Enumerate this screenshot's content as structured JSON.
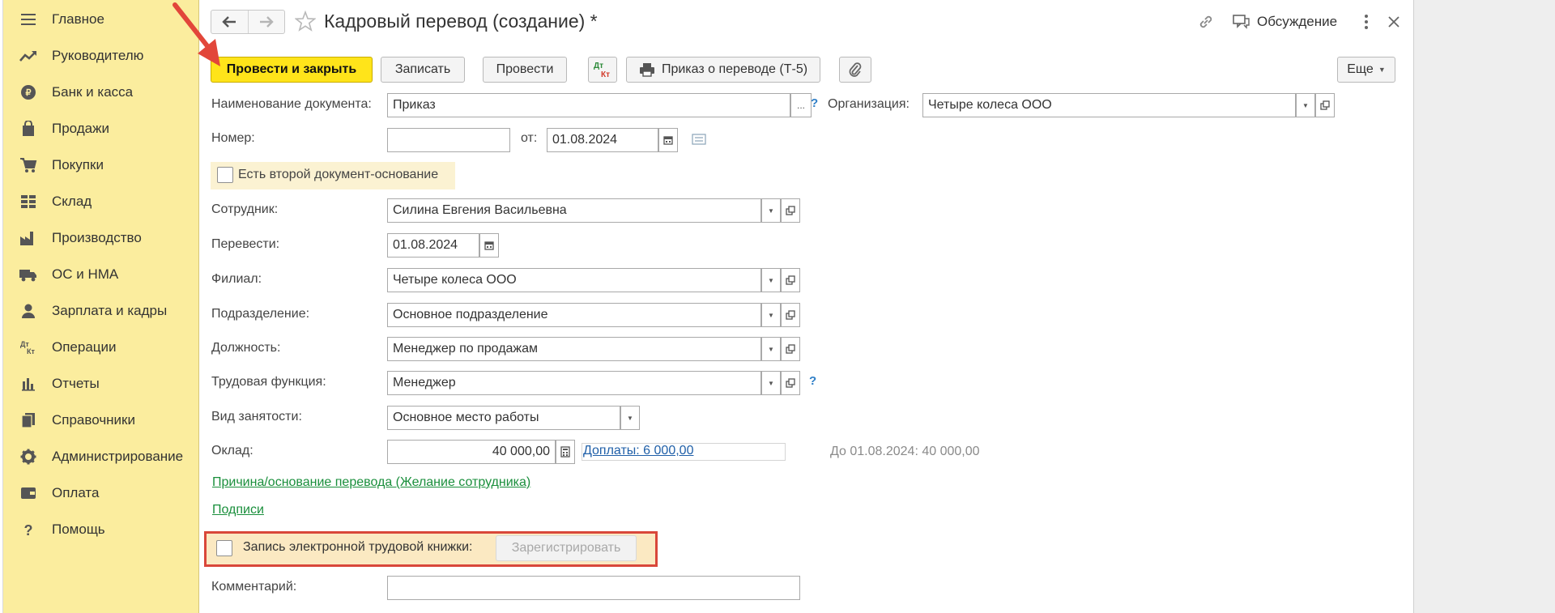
{
  "sidebar": {
    "items": [
      {
        "label": "Главное",
        "icon": "menu-lines-icon"
      },
      {
        "label": "Руководителю",
        "icon": "trend-chart-icon"
      },
      {
        "label": "Банк и касса",
        "icon": "coin-icon"
      },
      {
        "label": "Продажи",
        "icon": "shopping-bag-icon"
      },
      {
        "label": "Покупки",
        "icon": "cart-icon"
      },
      {
        "label": "Склад",
        "icon": "warehouse-grid-icon"
      },
      {
        "label": "Производство",
        "icon": "factory-icon"
      },
      {
        "label": "ОС и НМА",
        "icon": "truck-icon"
      },
      {
        "label": "Зарплата и кадры",
        "icon": "person-icon"
      },
      {
        "label": "Операции",
        "icon": "dt-kt-icon"
      },
      {
        "label": "Отчеты",
        "icon": "bar-chart-icon"
      },
      {
        "label": "Справочники",
        "icon": "book-icon"
      },
      {
        "label": "Администрирование",
        "icon": "gear-icon"
      },
      {
        "label": "Оплата",
        "icon": "wallet-icon"
      },
      {
        "label": "Помощь",
        "icon": "question-icon"
      }
    ]
  },
  "header": {
    "title": "Кадровый перевод (создание) *",
    "discuss_label": "Обсуждение"
  },
  "toolbar": {
    "post_close": "Провести и закрыть",
    "save": "Записать",
    "post": "Провести",
    "dt_kt": "Дт Кт",
    "print_order": "Приказ о переводе (Т-5)",
    "more": "Еще"
  },
  "form": {
    "doc_name_label": "Наименование документа:",
    "doc_name_value": "Приказ",
    "dots": "...",
    "help": "?",
    "org_label": "Организация:",
    "org_value": "Четыре колеса ООО",
    "number_label": "Номер:",
    "number_value": "",
    "from_label": "от:",
    "from_value": "01.08.2024",
    "second_basis_label": "Есть второй документ-основание",
    "employee_label": "Сотрудник:",
    "employee_value": "Силина Евгения Васильевна",
    "transfer_label": "Перевести:",
    "transfer_value": "01.08.2024",
    "branch_label": "Филиал:",
    "branch_value": "Четыре колеса ООО",
    "dept_label": "Подразделение:",
    "dept_value": "Основное подразделение",
    "position_label": "Должность:",
    "position_value": "Менеджер по продажам",
    "labor_func_label": "Трудовая функция:",
    "labor_func_value": "Менеджер",
    "employment_label": "Вид занятости:",
    "employment_value": "Основное место работы",
    "salary_label": "Оклад:",
    "salary_value": "40 000,00",
    "allowances_link": "Доплаты: 6 000,00",
    "salary_before": "До 01.08.2024: 40 000,00",
    "reason_link": "Причина/основание перевода (Желание сотрудника)",
    "signatures_link": "Подписи",
    "etk_label": "Запись электронной трудовой книжки:",
    "register_button": "Зарегистрировать",
    "comment_label": "Комментарий:",
    "comment_value": ""
  },
  "colors": {
    "sidebar_bg": "#fbed9e",
    "primary_button": "#ffe41a",
    "highlight_frame": "#d9473a",
    "annotation_arrow": "#e2463a",
    "link_green": "#1a8f3c",
    "link_blue": "#1f5fa8"
  }
}
